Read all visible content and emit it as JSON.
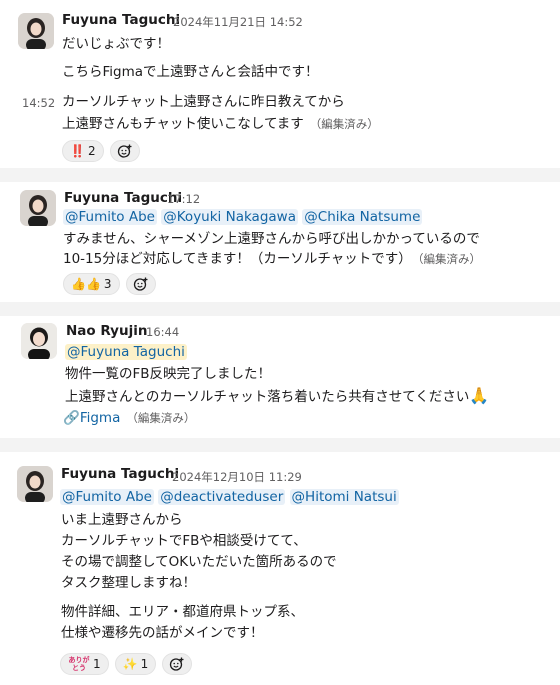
{
  "messages": [
    {
      "author": "Fuyuna Taguchi",
      "timestamp": "2024年11月21日 14:52",
      "lines": [
        "だいじょぶです！",
        "こちらFigmaで上遠野さんと会話中です！"
      ],
      "followup": {
        "time": "14:52",
        "lines": [
          "カーソルチャット上遠野さんに昨日教えてから",
          "上遠野さんもチャット使いこなしてます"
        ],
        "edited": "（編集済み）"
      },
      "reactions": [
        {
          "emoji": "‼️",
          "count": "2"
        }
      ]
    },
    {
      "author": "Fuyuna Taguchi",
      "timestamp": "17:12",
      "mentions": [
        "@Fumito Abe",
        "@Koyuki Nakagawa",
        "@Chika Natsume"
      ],
      "lines": [
        "すみません、シャーメゾン上遠野さんから呼び出しかかっているので",
        "10-15分ほど対応してきます！（カーソルチャットです）"
      ],
      "edited": "（編集済み）",
      "reactions": [
        {
          "emoji": "👍👍",
          "count": "3"
        }
      ]
    },
    {
      "author": "Nao Ryujin",
      "timestamp": "16:44",
      "mentions": [
        "@Fuyuna Taguchi"
      ],
      "lines": [
        "物件一覧のFB反映完了しました！",
        "上遠野さんとのカーソルチャット落ち着いたら共有させてください"
      ],
      "pray": "🙏",
      "link_icon": "🔗",
      "link_text": "Figma",
      "edited": "（編集済み）"
    },
    {
      "author": "Fuyuna Taguchi",
      "timestamp": "2024年12月10日 11:29",
      "mentions": [
        "@Fumito Abe",
        "@deactivateduser",
        "@Hitomi Natsui"
      ],
      "lines": [
        "いま上遠野さんから",
        "カーソルチャットでFBや相談受けてて、",
        "その場で調整してOKいただいた箇所あるので",
        "タスク整理しますね！"
      ],
      "lines2": [
        "物件詳細、エリア・都道府県トップ系、",
        "仕様や遷移先の話がメインです！"
      ],
      "reactions": [
        {
          "emoji": "ありがとう",
          "count": "1"
        },
        {
          "emoji": "✨",
          "count": "1"
        }
      ]
    }
  ]
}
